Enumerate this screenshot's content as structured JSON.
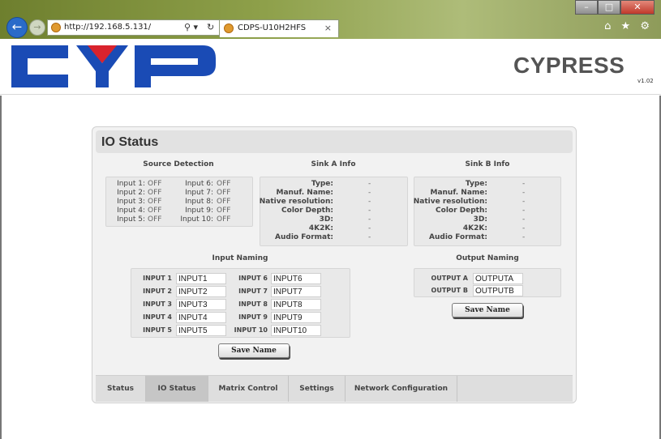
{
  "browser": {
    "address": "http://192.168.5.131/",
    "tab_title": "CDPS-U10H2HFS",
    "back_glyph": "←",
    "forward_glyph": "→",
    "search_glyph": "⚲ ▾",
    "refresh_glyph": "↻",
    "tab_close_glyph": "×",
    "toolbar_glyphs": "⌂ ★ ⚙",
    "window_buttons": {
      "minimize": "–",
      "maximize": "□",
      "close": "✕"
    }
  },
  "header": {
    "brand": "CYPRESS",
    "version": "v1.02",
    "logo_colors": {
      "blue": "#1a4bb5",
      "red": "#d9232d"
    }
  },
  "panel": {
    "title": "IO Status",
    "source_detection": {
      "heading": "Source Detection",
      "inputs": [
        {
          "label": "Input 1:",
          "value": "OFF"
        },
        {
          "label": "Input 2:",
          "value": "OFF"
        },
        {
          "label": "Input 3:",
          "value": "OFF"
        },
        {
          "label": "Input 4:",
          "value": "OFF"
        },
        {
          "label": "Input 5:",
          "value": "OFF"
        },
        {
          "label": "Input 6:",
          "value": "OFF"
        },
        {
          "label": "Input 7:",
          "value": "OFF"
        },
        {
          "label": "Input 8:",
          "value": "OFF"
        },
        {
          "label": "Input 9:",
          "value": "OFF"
        },
        {
          "label": "Input 10:",
          "value": "OFF"
        }
      ]
    },
    "sink_a": {
      "heading": "Sink A Info",
      "rows": [
        {
          "label": "Type:",
          "value": "-"
        },
        {
          "label": "Manuf. Name:",
          "value": "-"
        },
        {
          "label": "Native resolution:",
          "value": "-"
        },
        {
          "label": "Color Depth:",
          "value": "-"
        },
        {
          "label": "3D:",
          "value": "-"
        },
        {
          "label": "4K2K:",
          "value": "-"
        },
        {
          "label": "Audio Format:",
          "value": "-"
        }
      ]
    },
    "sink_b": {
      "heading": "Sink B Info",
      "rows": [
        {
          "label": "Type:",
          "value": "-"
        },
        {
          "label": "Manuf. Name:",
          "value": "-"
        },
        {
          "label": "Native resolution:",
          "value": "-"
        },
        {
          "label": "Color Depth:",
          "value": "-"
        },
        {
          "label": "3D:",
          "value": "-"
        },
        {
          "label": "4K2K:",
          "value": "-"
        },
        {
          "label": "Audio Format:",
          "value": "-"
        }
      ]
    },
    "input_naming": {
      "heading": "Input Naming",
      "inputs": [
        {
          "label": "INPUT 1",
          "value": "INPUT1"
        },
        {
          "label": "INPUT 2",
          "value": "INPUT2"
        },
        {
          "label": "INPUT 3",
          "value": "INPUT3"
        },
        {
          "label": "INPUT 4",
          "value": "INPUT4"
        },
        {
          "label": "INPUT 5",
          "value": "INPUT5"
        },
        {
          "label": "INPUT 6",
          "value": "INPUT6"
        },
        {
          "label": "INPUT 7",
          "value": "INPUT7"
        },
        {
          "label": "INPUT 8",
          "value": "INPUT8"
        },
        {
          "label": "INPUT 9",
          "value": "INPUT9"
        },
        {
          "label": "INPUT 10",
          "value": "INPUT10"
        }
      ],
      "save_label": "Save Name"
    },
    "output_naming": {
      "heading": "Output Naming",
      "outputs": [
        {
          "label": "OUTPUT A",
          "value": "OUTPUTA"
        },
        {
          "label": "OUTPUT B",
          "value": "OUTPUTB"
        }
      ],
      "save_label": "Save Name"
    },
    "tabs": [
      {
        "label": "Status"
      },
      {
        "label": "IO Status"
      },
      {
        "label": "Matrix Control"
      },
      {
        "label": "Settings"
      },
      {
        "label": "Network Configuration"
      }
    ]
  }
}
